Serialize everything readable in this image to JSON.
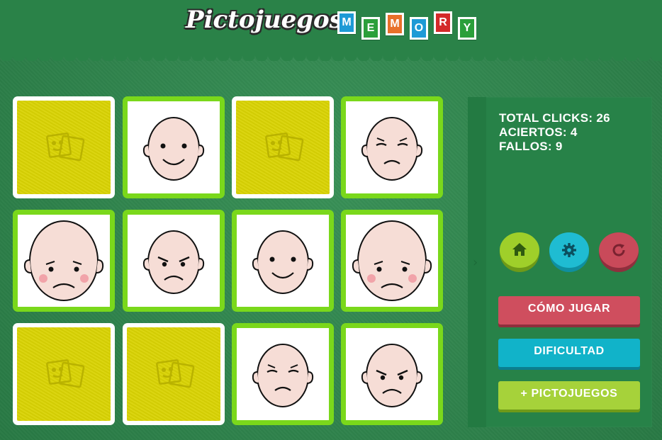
{
  "header": {
    "logo_text": "Pictojuegos",
    "memory_letters": [
      {
        "letter": "M",
        "color": "#1e9ad6"
      },
      {
        "letter": "E",
        "color": "#2a9f3a"
      },
      {
        "letter": "M",
        "color": "#e8702a"
      },
      {
        "letter": "O",
        "color": "#1e9ad6"
      },
      {
        "letter": "R",
        "color": "#d42a2a"
      },
      {
        "letter": "Y",
        "color": "#2a9f3a"
      }
    ]
  },
  "board": {
    "card_back_icon": "pictogram-logo-icon",
    "cards": [
      {
        "state": "hidden"
      },
      {
        "state": "revealed",
        "face": "happy-face-icon"
      },
      {
        "state": "hidden"
      },
      {
        "state": "revealed",
        "face": "wincing-face-icon"
      },
      {
        "state": "revealed",
        "face": "sad-blushing-face-icon"
      },
      {
        "state": "revealed",
        "face": "angry-face-icon"
      },
      {
        "state": "revealed",
        "face": "happy-face-icon"
      },
      {
        "state": "revealed",
        "face": "sad-blushing-face-icon"
      },
      {
        "state": "hidden"
      },
      {
        "state": "hidden"
      },
      {
        "state": "revealed",
        "face": "wincing-face-icon"
      },
      {
        "state": "revealed",
        "face": "angry-face-icon"
      }
    ]
  },
  "stats": {
    "total_clicks": "TOTAL CLICKS: 26",
    "aciertos": "ACIERTOS: 4",
    "fallos": "FALLOS: 9"
  },
  "controls": {
    "home_icon": "home-icon",
    "settings_icon": "gear-icon",
    "restart_icon": "restart-icon",
    "home_color": "#9fcf2a",
    "settings_color": "#1fbcd2",
    "restart_color": "#c94a5a"
  },
  "buttons": {
    "como_jugar": "CÓMO JUGAR",
    "dificultad": "DIFICULTAD",
    "mas_pictojuegos": "+ PICTOJUEGOS",
    "como_jugar_color": "#cf4e5e",
    "dificultad_color": "#11b3c9",
    "mas_pictojuegos_color": "#a6d23a"
  }
}
